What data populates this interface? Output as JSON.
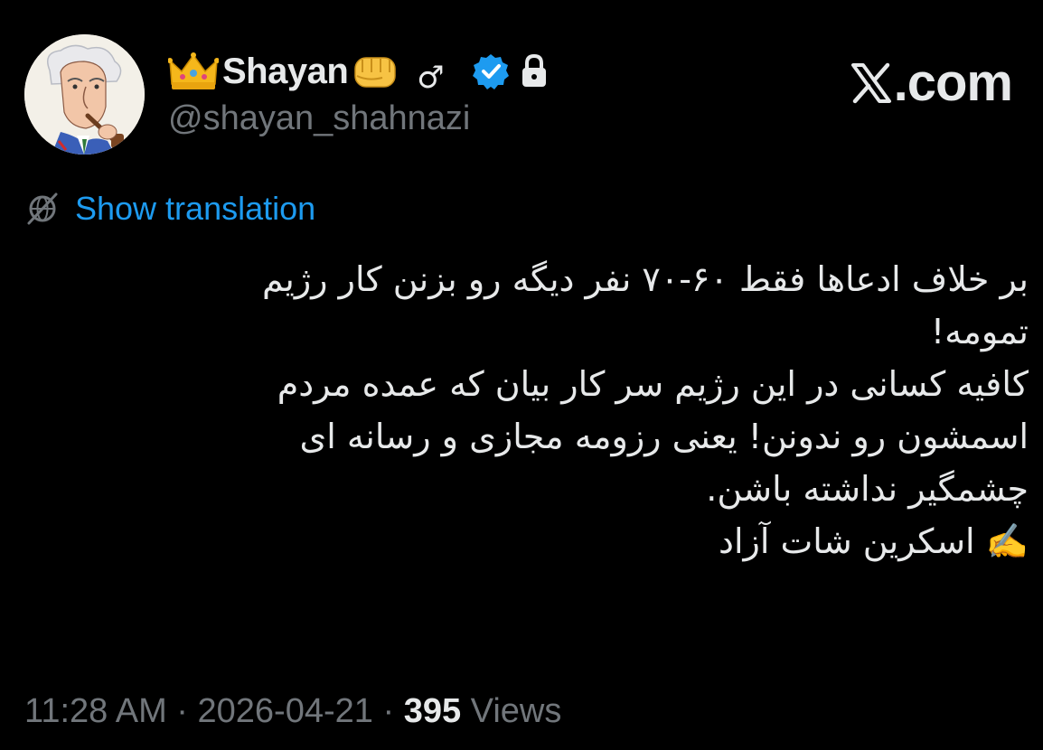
{
  "author": {
    "display_name": "Shayan",
    "gender_symbol": "♂",
    "handle": "@shayan_shahnazi",
    "crown_icon": "crown-emoji-icon",
    "fist_icon": "oncoming-fist-emoji-icon",
    "verified_icon": "verified-badge-icon",
    "lock_icon": "lock-icon"
  },
  "watermark": {
    "text": ".com"
  },
  "translation": {
    "label": "Show translation",
    "icon": "translate-globe-icon"
  },
  "tweet": {
    "lines": [
      "بر خلاف ادعاها فقط ۶۰-۷۰ نفر دیگه رو بزنن کار رژیم",
      "تمومه!",
      "کافیه کسانی در این رژیم سر کار بیان که عمده مردم",
      "اسمشون رو ندونن! یعنی رزومه مجازی و رسانه ای",
      "چشمگیر نداشته باشن.",
      "✍️ اسکرین شات آزاد"
    ]
  },
  "meta": {
    "time": "11:28 AM",
    "separator": "·",
    "date": "2026-04-21",
    "views_count": "395",
    "views_label": "Views"
  },
  "colors": {
    "background": "#000000",
    "text": "#e7e9ea",
    "muted": "#71767b",
    "link": "#1d9bf0"
  }
}
